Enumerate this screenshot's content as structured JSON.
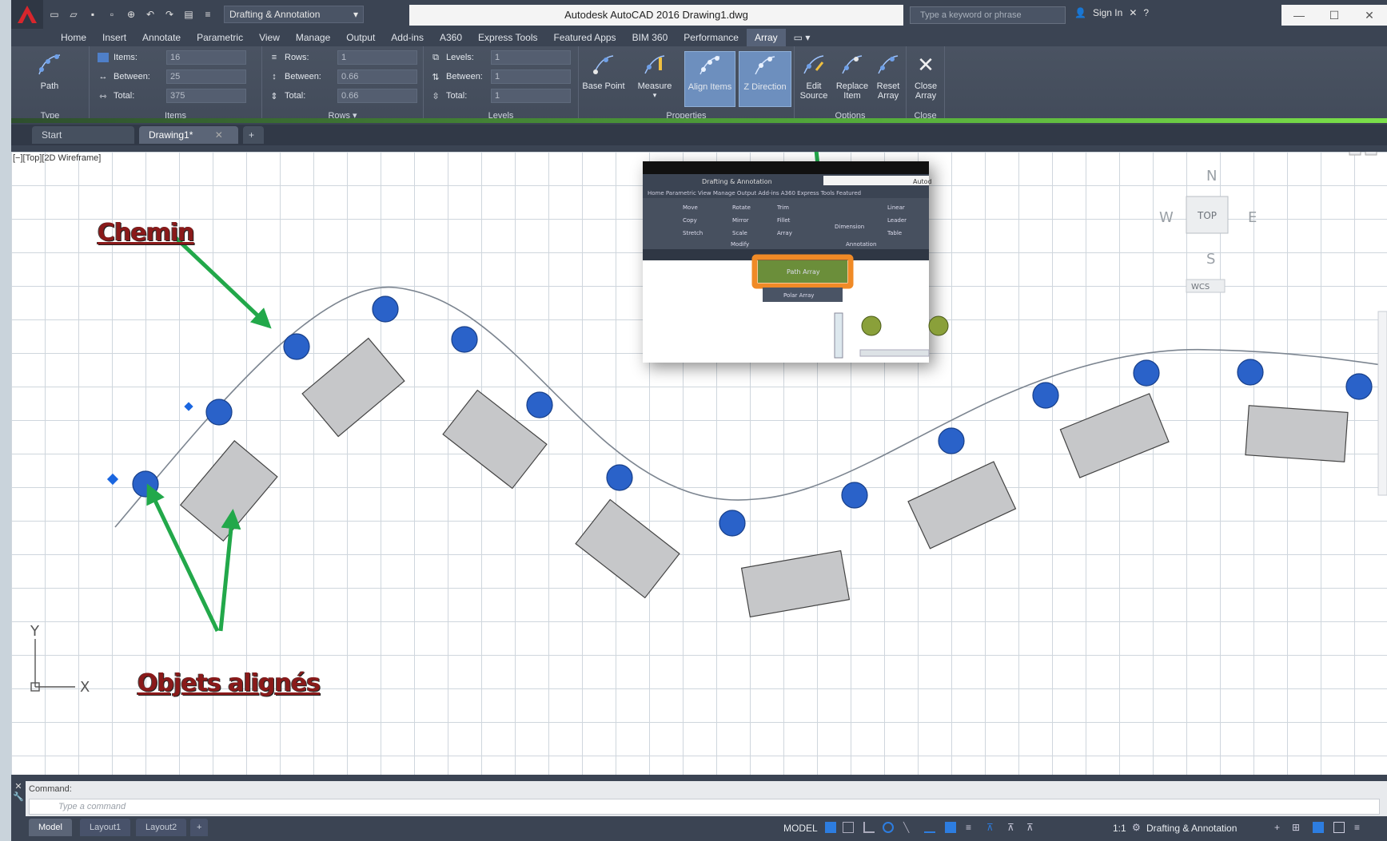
{
  "window": {
    "title": "Autodesk AutoCAD 2016    Drawing1.dwg",
    "workspace": "Drafting & Annotation",
    "search_placeholder": "Type a keyword or phrase",
    "sign_in": "Sign In"
  },
  "menu_tabs": [
    "Home",
    "Insert",
    "Annotate",
    "Parametric",
    "View",
    "Manage",
    "Output",
    "Add-ins",
    "A360",
    "Express Tools",
    "Featured Apps",
    "BIM 360",
    "Performance",
    "Array"
  ],
  "ribbon": {
    "type_panel": {
      "title": "Type",
      "path_label": "Path"
    },
    "items_panel": {
      "title": "Items",
      "items_label": "Items:",
      "items_value": "16",
      "between_label": "Between:",
      "between_value": "25",
      "total_label": "Total:",
      "total_value": "375"
    },
    "rows_panel": {
      "title": "Rows",
      "rows_label": "Rows:",
      "rows_value": "1",
      "between_label": "Between:",
      "between_value": "0.66",
      "total_label": "Total:",
      "total_value": "0.66"
    },
    "levels_panel": {
      "title": "Levels",
      "levels_label": "Levels:",
      "levels_value": "1",
      "between_label": "Between:",
      "between_value": "1",
      "total_label": "Total:",
      "total_value": "1"
    },
    "properties_panel": {
      "title": "Properties",
      "base_point": "Base Point",
      "measure": "Measure",
      "align_items": "Align Items",
      "z_direction": "Z Direction"
    },
    "options_panel": {
      "title": "Options",
      "edit_source_1": "Edit",
      "edit_source_2": "Source",
      "replace_item_1": "Replace",
      "replace_item_2": "Item",
      "reset_array_1": "Reset",
      "reset_array_2": "Array"
    },
    "close_panel": {
      "title": "Close",
      "close_1": "Close",
      "close_2": "Array"
    }
  },
  "file_tabs": {
    "start": "Start",
    "drawing": "Drawing1*"
  },
  "viewport": {
    "label": "[−][Top][2D Wireframe]",
    "viewcube": {
      "n": "N",
      "s": "S",
      "e": "E",
      "w": "W",
      "top": "TOP",
      "wcs": "WCS"
    },
    "ucs_x": "X",
    "ucs_y": "Y"
  },
  "annotations": {
    "path_label": "Chemin",
    "objects_label": "Objets alignés"
  },
  "inset": {
    "workspace": "Drafting & Annotation",
    "title_fragment": "Autod",
    "tabs": "Home   Parametric   View   Manage   Output   Add-ins   A360   Express Tools   Featured",
    "modify_rows": [
      [
        "Move",
        "Rotate",
        "Trim"
      ],
      [
        "Copy",
        "Mirror",
        "Fillet"
      ],
      [
        "Stretch",
        "Scale",
        "Array"
      ]
    ],
    "dimension": "Dimension",
    "linear": "Linear",
    "leader": "Leader",
    "table": "Table",
    "modify_title": "Modify",
    "annotation_title": "Annotation",
    "path_array": "Path Array",
    "polar_array": "Polar Array"
  },
  "command": {
    "history": "Command:",
    "placeholder": "Type a command"
  },
  "status": {
    "layout_tabs": [
      "Model",
      "Layout1",
      "Layout2"
    ],
    "model": "MODEL",
    "scale": "1:1",
    "workspace": "Drafting & Annotation"
  },
  "colors": {
    "tree": "#2a62c9",
    "box_fill": "#c6c7c9",
    "arrow": "#22a84a",
    "annotation_text": "#8a1a1a",
    "highlight": "#f08a26"
  }
}
